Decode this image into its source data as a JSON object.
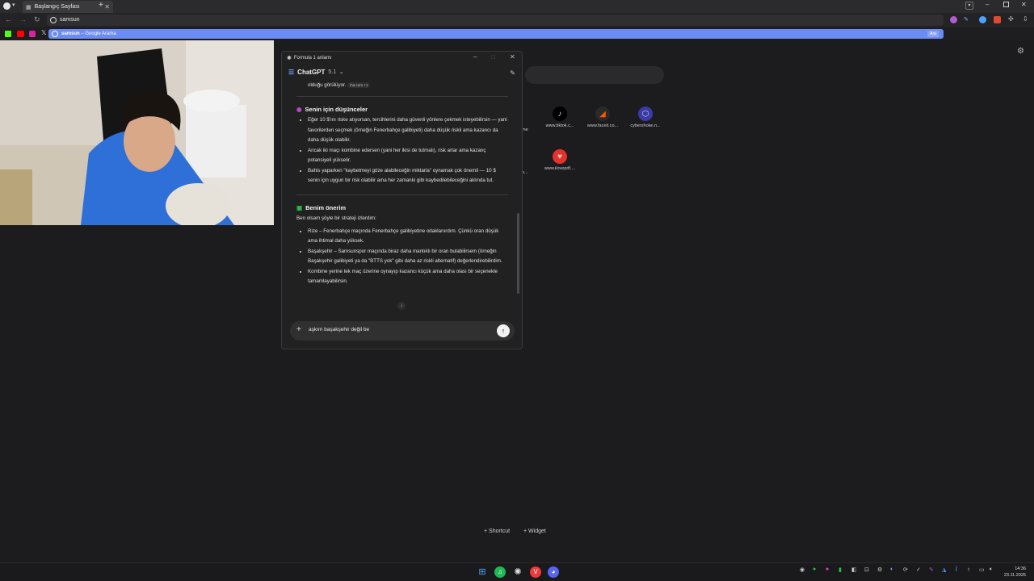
{
  "browser": {
    "tab_title": "Başlangıç Sayfası",
    "address_text": "samsun",
    "suggestion_bold": "samsun",
    "suggestion_rest": " – Google Arama",
    "suggestion_tag": "Ara"
  },
  "speed_dial": [
    {
      "label": "www.tiktok.c...",
      "icon": "tiktok-icon",
      "color": "#000000"
    },
    {
      "label": "www.faceit.co...",
      "icon": "faceit-icon",
      "color": "#ff5500"
    },
    {
      "label": "cybershoke.n...",
      "icon": "cybershoke-icon",
      "color": "#3a3aa8"
    },
    {
      "label": "www.ilovepdf....",
      "icon": "ilovepdf-icon",
      "color": "#e5322d"
    }
  ],
  "footer": {
    "shortcut": "Shortcut",
    "widget": "Widget"
  },
  "chat": {
    "window_title": "Formula 1 anlamı",
    "model_name": "ChatGPT",
    "model_version": "5.1",
    "top_line": "olduğu görülüyor.",
    "top_source": "iha.com +1",
    "section1_title": "Senin için düşünceler",
    "section1_items": [
      "Eğer 10 $'ını riske atıyorsan, tercihlerini daha güvenli yönlere çekmek isteyebilirsin — yani favorilerden seçmek (örneğin Fenerbahçe galibiyeti) daha düşük riskli ama kazancı da daha düşük olabilir.",
      "Ancak iki maçı kombine edersen (yani her ikisi de tutmalı), risk artar ama kazanç potansiyeli yükselir.",
      "Bahis yaparken \"kaybetmeyi göze alabileceğin miktarla\" oynamak çok önemli — 10 $ senin için uygun bir risk olabilir ama her zamanki gibi kaybedilebileceğini aklında tut."
    ],
    "section2_title": "Benim önerim",
    "section2_intro": "Ben olsam şöyle bir strateji izlerdim:",
    "section2_items": [
      "Rize – Fenerbahçe maçında Fenerbahçe galibiyetine odaklanırdım. Çünkü oran düşük ama ihtimal daha yüksek.",
      "Başakşehir – Samsunspor maçında biraz daha mantıklı bir oran bulabilirsem (örneğin Başakşehir galibiyeti ya da \"BTTS yok\" gibi daha az riskli alternatif) değerlendirebilirdim.",
      "Kombine yerine tek maç üzerine oynayıp kazancı küçük ama daha olası bir seçenekle tamamlayabilirsin."
    ],
    "composer_text": "aşkım başakşehir değil be"
  },
  "taskbar": {
    "time": "14:36",
    "date": "23.11.2025"
  }
}
